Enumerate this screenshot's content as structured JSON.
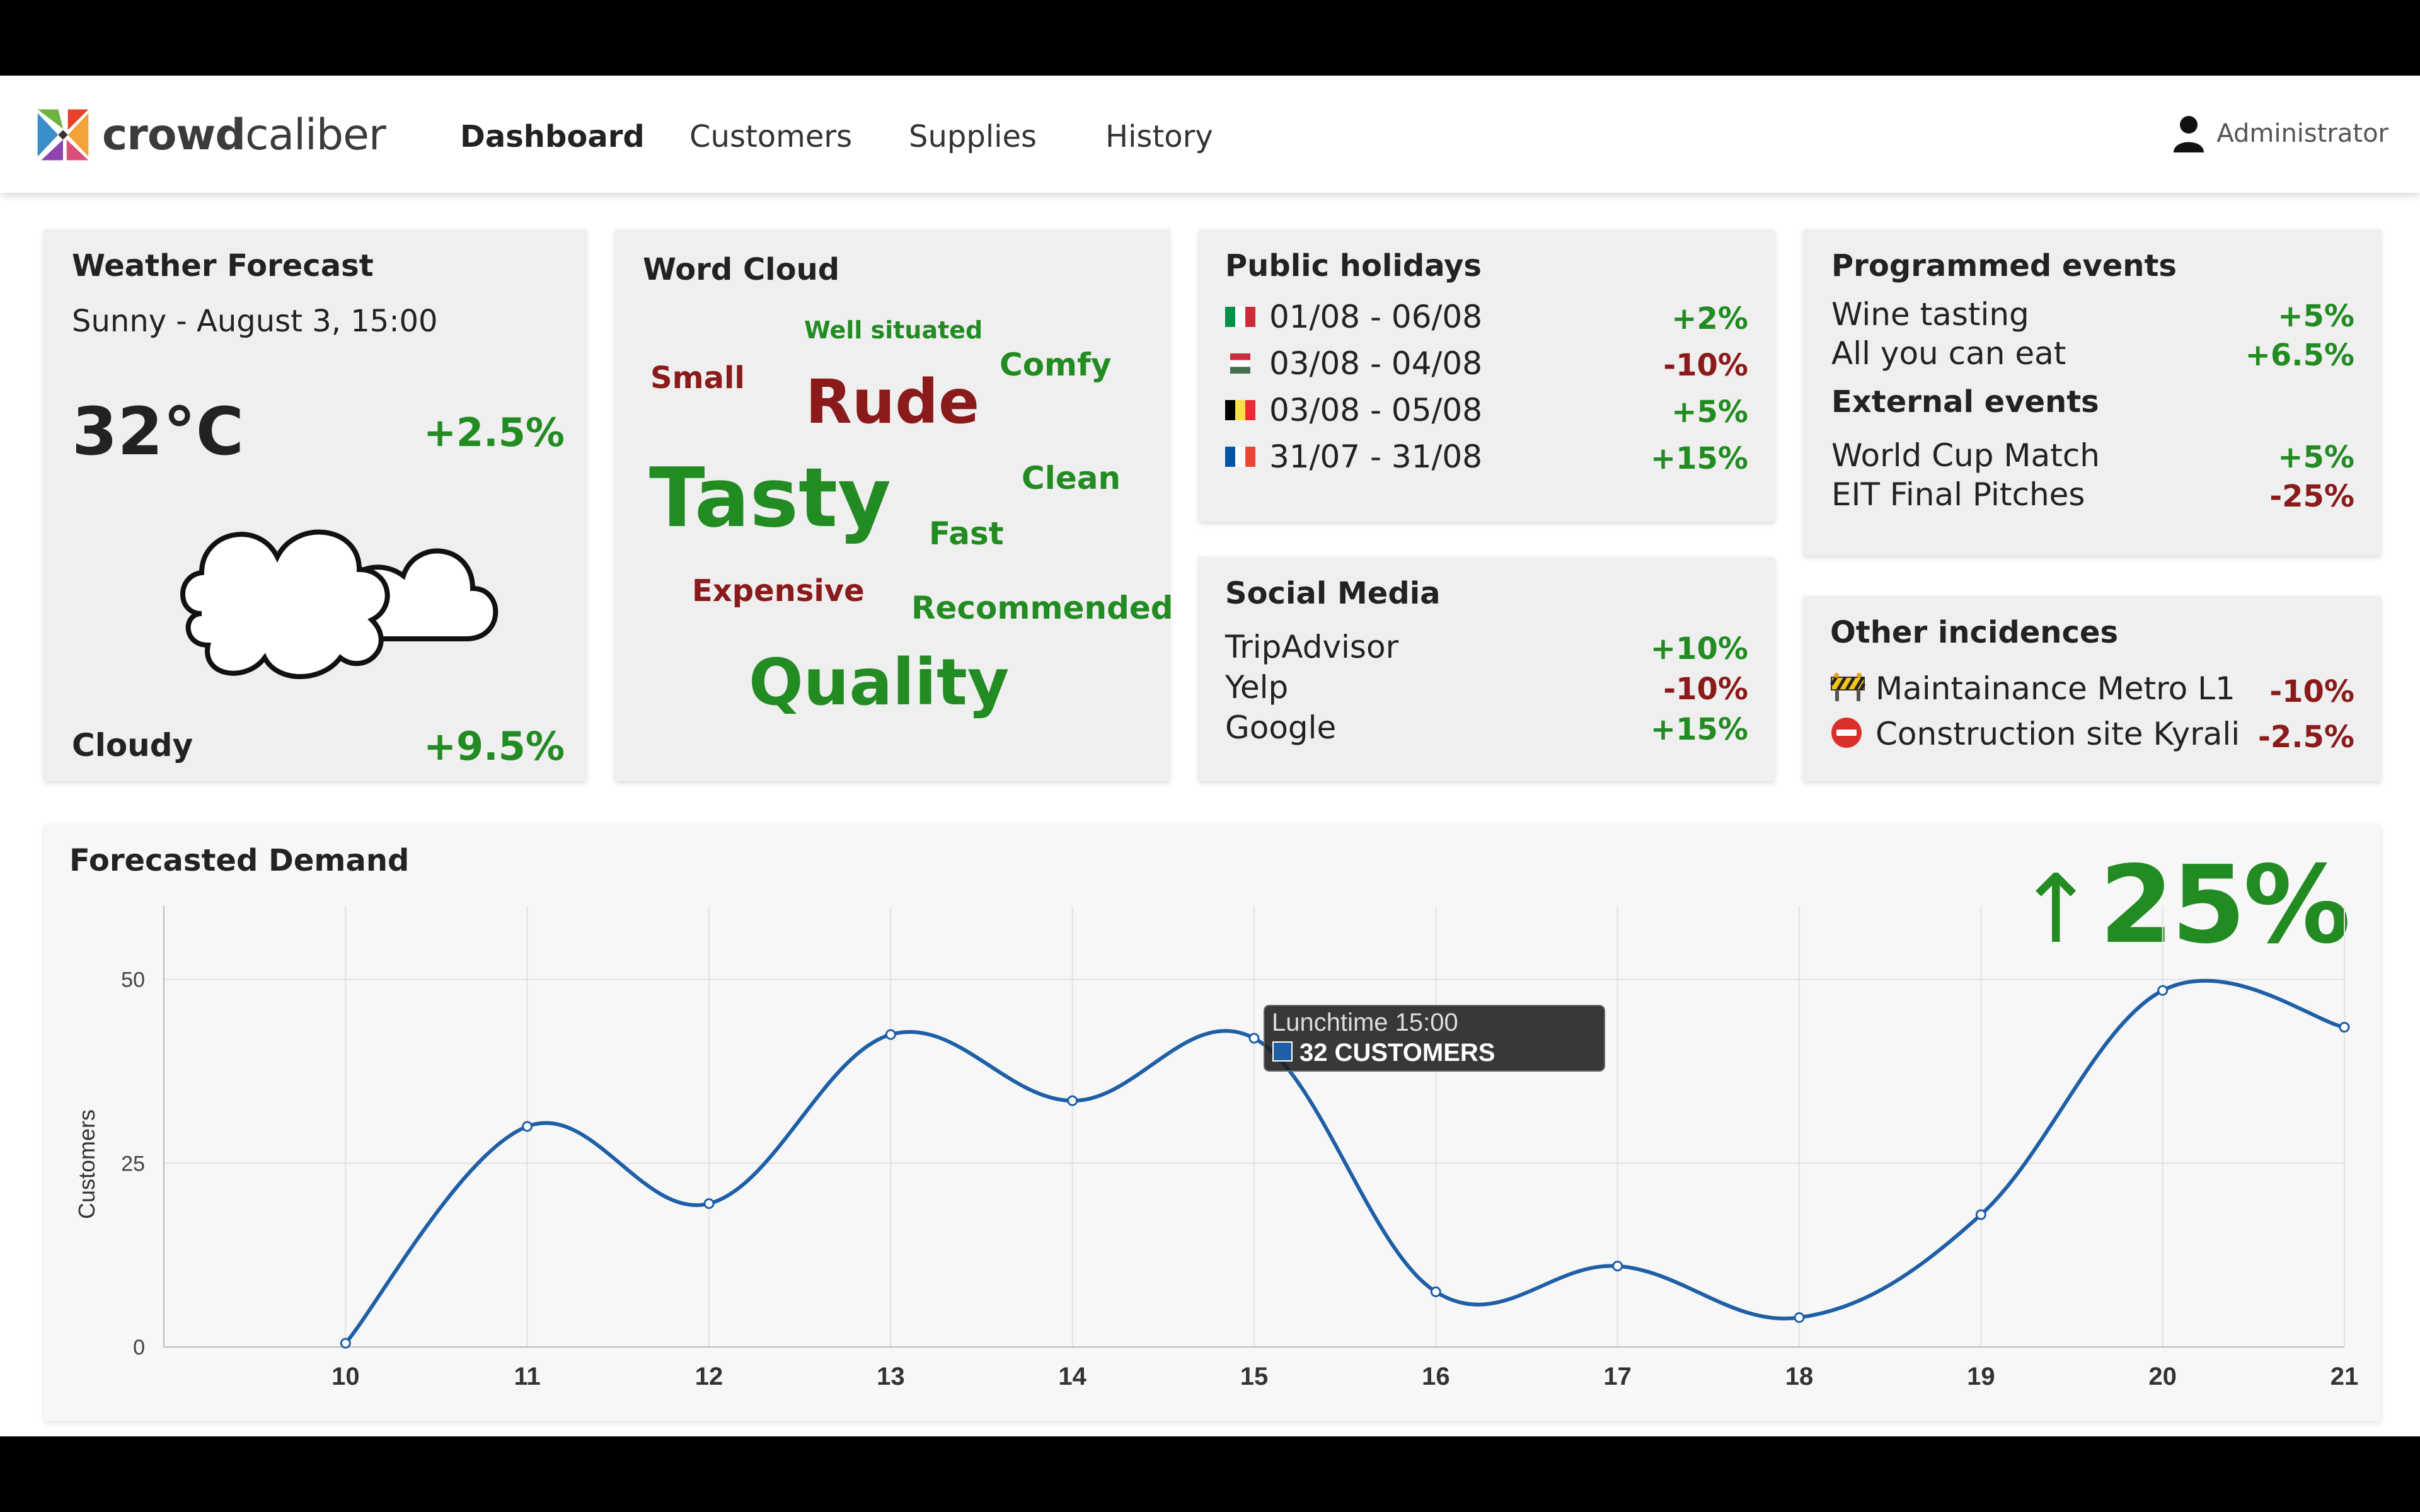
{
  "brand": {
    "name_bold": "crowd",
    "name_light": "caliber"
  },
  "nav": {
    "items": [
      "Dashboard",
      "Customers",
      "Supplies",
      "History"
    ],
    "active": "Dashboard"
  },
  "user": {
    "label": "Administrator",
    "icon": "user-icon"
  },
  "weather": {
    "title": "Weather Forecast",
    "subtitle": "Sunny - August 3, 15:00",
    "temperature": "32°C",
    "temperature_delta": "+2.5%",
    "icon": "cloud-icon",
    "condition": "Cloudy",
    "condition_delta": "+9.5%"
  },
  "word_cloud": {
    "title": "Word Cloud",
    "words": [
      {
        "text": "Well situated",
        "sentiment": "positive"
      },
      {
        "text": "Small",
        "sentiment": "negative"
      },
      {
        "text": "Rude",
        "sentiment": "negative"
      },
      {
        "text": "Comfy",
        "sentiment": "positive"
      },
      {
        "text": "Tasty",
        "sentiment": "positive"
      },
      {
        "text": "Clean",
        "sentiment": "positive"
      },
      {
        "text": "Fast",
        "sentiment": "positive"
      },
      {
        "text": "Expensive",
        "sentiment": "negative"
      },
      {
        "text": "Recommended",
        "sentiment": "positive"
      },
      {
        "text": "Quality",
        "sentiment": "positive"
      }
    ]
  },
  "holidays": {
    "title": "Public holidays",
    "items": [
      {
        "flag": "italy-flag-icon",
        "dates": "01/08 - 06/08",
        "delta": "+2%",
        "sign": "pos"
      },
      {
        "flag": "hungary-flag-icon",
        "dates": "03/08 - 04/08",
        "delta": "-10%",
        "sign": "neg"
      },
      {
        "flag": "belgium-flag-icon",
        "dates": "03/08 - 05/08",
        "delta": "+5%",
        "sign": "pos"
      },
      {
        "flag": "france-flag-icon",
        "dates": "31/07 - 31/08",
        "delta": "+15%",
        "sign": "pos"
      }
    ]
  },
  "social": {
    "title": "Social Media",
    "items": [
      {
        "name": "TripAdvisor",
        "delta": "+10%",
        "sign": "pos"
      },
      {
        "name": "Yelp",
        "delta": "-10%",
        "sign": "neg"
      },
      {
        "name": "Google",
        "delta": "+15%",
        "sign": "pos"
      }
    ]
  },
  "events": {
    "programmed_title": "Programmed events",
    "programmed": [
      {
        "name": "Wine tasting",
        "delta": "+5%",
        "sign": "pos"
      },
      {
        "name": "All you can eat",
        "delta": "+6.5%",
        "sign": "pos"
      }
    ],
    "external_title": "External events",
    "external": [
      {
        "name": "World Cup Match",
        "delta": "+5%",
        "sign": "pos"
      },
      {
        "name": "EIT Final Pitches",
        "delta": "-25%",
        "sign": "neg"
      }
    ]
  },
  "incidences": {
    "title": "Other incidences",
    "items": [
      {
        "icon": "roadworks-icon",
        "name": "Maintainance Metro L1",
        "delta": "-10%",
        "sign": "neg"
      },
      {
        "icon": "no-entry-icon",
        "name": "Construction site Kyrali",
        "delta": "-2.5%",
        "sign": "neg"
      }
    ]
  },
  "demand": {
    "title": "Forecasted Demand",
    "trend_arrow": "↑",
    "trend_value": "25%",
    "tooltip": {
      "title": "Lunchtime 15:00",
      "value": "32 CUSTOMERS"
    }
  },
  "colors": {
    "positive": "#228b22",
    "negative": "#8b1a1a",
    "line": "#1f5fa6",
    "card": "#efefef"
  },
  "chart_data": {
    "type": "line",
    "x": [
      10,
      11,
      12,
      13,
      14,
      15,
      16,
      17,
      18,
      19,
      20,
      21
    ],
    "series": [
      {
        "values": [
          0.5,
          30,
          19.5,
          42.5,
          33.5,
          42,
          7.5,
          11,
          4,
          18,
          48.5,
          43.5
        ]
      }
    ],
    "ylabel": "Customers",
    "yticks": [
      0,
      25,
      50
    ],
    "ylim": [
      0,
      60
    ],
    "xlim": [
      9,
      21
    ],
    "grid": true
  }
}
